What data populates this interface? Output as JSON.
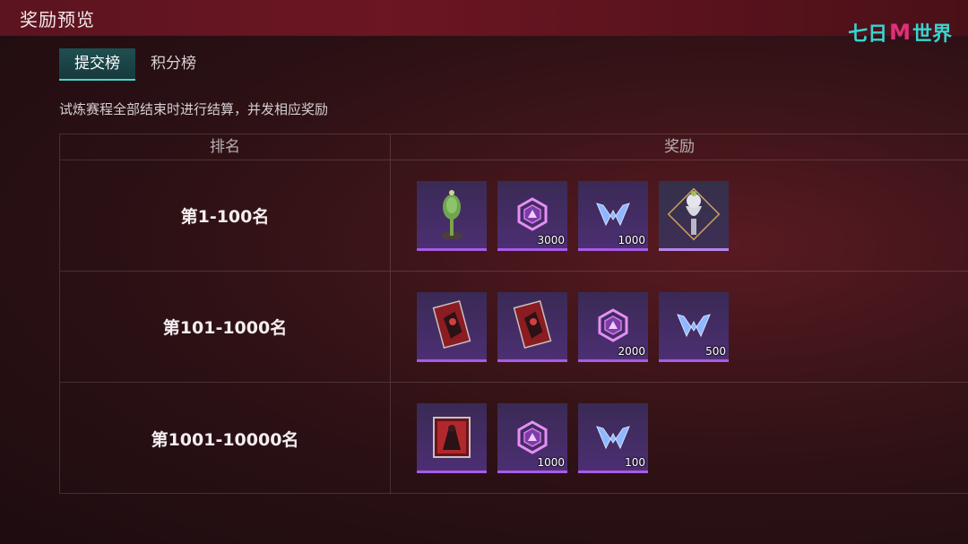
{
  "header": {
    "title": "奖励预览"
  },
  "logo": {
    "text_left": "七日",
    "text_mid": "M",
    "text_right": "世界"
  },
  "tabs": [
    {
      "label": "提交榜",
      "active": true
    },
    {
      "label": "积分榜",
      "active": false
    }
  ],
  "description": "试炼赛程全部结束时进行结算，并发相应奖励",
  "table": {
    "headers": {
      "rank": "排名",
      "reward": "奖励"
    },
    "rows": [
      {
        "rank": "第1-100名",
        "rewards": [
          {
            "icon": "green-cactus-figurine-icon",
            "qty": ""
          },
          {
            "icon": "purple-hexagon-token-icon",
            "qty": "3000"
          },
          {
            "icon": "blue-m-crystal-icon",
            "qty": "1000"
          },
          {
            "icon": "silver-torch-trophy-icon",
            "qty": ""
          }
        ]
      },
      {
        "rank": "第101-1000名",
        "rewards": [
          {
            "icon": "red-card-icon",
            "qty": ""
          },
          {
            "icon": "red-card-icon",
            "qty": ""
          },
          {
            "icon": "purple-hexagon-token-icon",
            "qty": "2000"
          },
          {
            "icon": "blue-m-crystal-icon",
            "qty": "500"
          }
        ]
      },
      {
        "rank": "第1001-10000名",
        "rewards": [
          {
            "icon": "red-framed-picture-icon",
            "qty": ""
          },
          {
            "icon": "purple-hexagon-token-icon",
            "qty": "1000"
          },
          {
            "icon": "blue-m-crystal-icon",
            "qty": "100"
          }
        ]
      }
    ]
  },
  "colors": {
    "accent_teal": "#46d9c8",
    "item_border_purple": "#a85be6",
    "logo_teal": "#38d4d0",
    "logo_pink": "#e0307a"
  }
}
